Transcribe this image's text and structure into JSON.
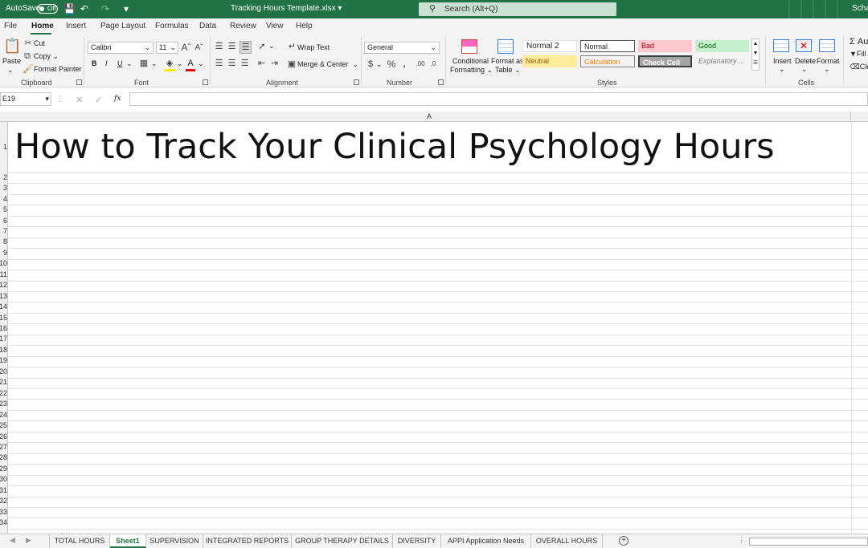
{
  "titlebar": {
    "autosave_label": "AutoSave",
    "autosave_state": "Off",
    "doc_title": "Tracking Hours Template.xlsx",
    "search_placeholder": "Search (Alt+Q)",
    "user": "Schae",
    "color": "#217346"
  },
  "menu": {
    "items": [
      "File",
      "Home",
      "Insert",
      "Page Layout",
      "Formulas",
      "Data",
      "Review",
      "View",
      "Help"
    ],
    "active": "Home"
  },
  "ribbon": {
    "clipboard": {
      "paste": "Paste",
      "cut": "Cut",
      "copy": "Copy",
      "format_painter": "Format Painter",
      "label": "Clipboard"
    },
    "font": {
      "name": "Calibri",
      "size": "11",
      "bold": "B",
      "italic": "I",
      "underline": "U",
      "label": "Font"
    },
    "alignment": {
      "wrap_text": "Wrap Text",
      "merge_center": "Merge & Center",
      "label": "Alignment"
    },
    "number": {
      "format": "General",
      "label": "Number"
    },
    "styles": {
      "conditional": "Conditional",
      "formatting": "Formatting",
      "format_as": "Format as",
      "table": "Table",
      "cells": [
        {
          "text": "Normal 2"
        },
        {
          "text": "Normal"
        },
        {
          "text": "Bad"
        },
        {
          "text": "Good"
        },
        {
          "text": "Neutral"
        },
        {
          "text": "Calculation"
        },
        {
          "text": "Check Cell"
        },
        {
          "text": "Explanatory ..."
        }
      ],
      "label": "Styles"
    },
    "cells": {
      "insert": "Insert",
      "delete": "Delete",
      "format": "Format",
      "label": "Cells"
    },
    "editing": {
      "autosum": "Au",
      "fill": "Fill",
      "clear": "Cle"
    }
  },
  "formula_bar": {
    "name_box": "E19",
    "fx": "fx",
    "value": ""
  },
  "sheet": {
    "column_a": "A",
    "heading": "How to Track Your Clinical Psychology Hours",
    "row_numbers": [
      "1",
      "2",
      "3",
      "4",
      "5",
      "6",
      "7",
      "8",
      "9",
      "10",
      "11",
      "12",
      "13",
      "14",
      "15",
      "16",
      "17",
      "18",
      "19",
      "20",
      "21",
      "22",
      "23",
      "24",
      "25",
      "26",
      "27",
      "28",
      "29",
      "30",
      "31",
      "32",
      "33",
      "34"
    ]
  },
  "tabs": {
    "items": [
      "TOTAL HOURS",
      "Sheet1",
      "SUPERVISION",
      "INTEGRATED REPORTS",
      "GROUP THERAPY DETAILS",
      "DIVERSITY",
      "APPI Application Needs",
      "OVERALL HOURS"
    ],
    "active": "Sheet1"
  }
}
